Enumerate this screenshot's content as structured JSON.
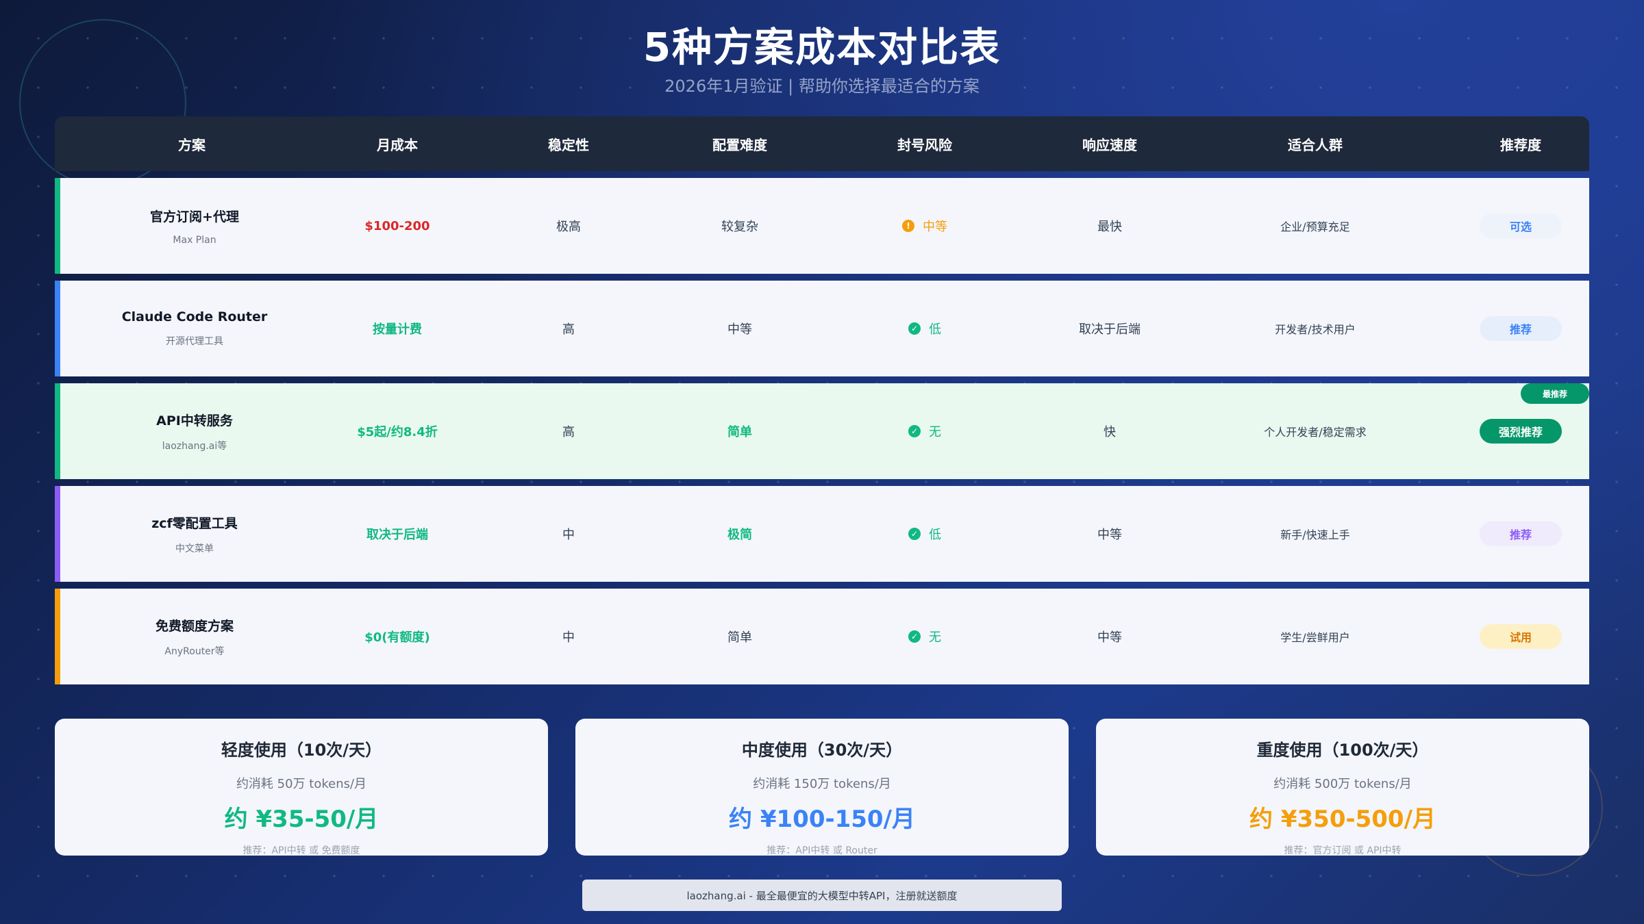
{
  "title": "5种方案成本对比表",
  "subtitle": "2026年1月验证 | 帮助你选择最适合的方案",
  "headers": [
    "方案",
    "月成本",
    "稳定性",
    "配置难度",
    "封号风险",
    "响应速度",
    "适合人群",
    "推荐度"
  ],
  "rows": [
    {
      "name": "官方订阅+代理",
      "sub": "Max Plan",
      "cost": "$100-200",
      "stability": "极高",
      "difficulty": "较复杂",
      "risk": "中等",
      "risk_icon": "!",
      "speed": "最快",
      "audience": "企业/预算充足",
      "recommend": "可选",
      "accent": "#10b981",
      "cost_color": "#dc2626",
      "difficulty_color": "#334155",
      "risk_color": "#f59e0b",
      "pill_bg": "#eef3fb",
      "pill_color": "#3b82f6"
    },
    {
      "name": "Claude Code Router",
      "sub": "开源代理工具",
      "cost": "按量计费",
      "stability": "高",
      "difficulty": "中等",
      "risk": "低",
      "risk_icon": "✓",
      "speed": "取决于后端",
      "audience": "开发者/技术用户",
      "recommend": "推荐",
      "accent": "#3b82f6",
      "cost_color": "#10b981",
      "difficulty_color": "#334155",
      "risk_color": "#10b981",
      "pill_bg": "#e6eefc",
      "pill_color": "#3b82f6"
    },
    {
      "name": "API中转服务",
      "sub": "laozhang.ai等",
      "cost": "$5起/约8.4折",
      "stability": "高",
      "difficulty": "简单",
      "risk": "无",
      "risk_icon": "✓",
      "speed": "快",
      "audience": "个人开发者/稳定需求",
      "recommend": "强烈推荐",
      "top_badge": "最推荐",
      "accent": "#10b981",
      "cost_color": "#10b981",
      "difficulty_color": "#10b981",
      "risk_color": "#10b981",
      "pill_bg": "#059669",
      "pill_color": "#ffffff"
    },
    {
      "name": "zcf零配置工具",
      "sub": "中文菜单",
      "cost": "取决于后端",
      "stability": "中",
      "difficulty": "极简",
      "risk": "低",
      "risk_icon": "✓",
      "speed": "中等",
      "audience": "新手/快速上手",
      "recommend": "推荐",
      "accent": "#8b5cf6",
      "cost_color": "#10b981",
      "difficulty_color": "#10b981",
      "risk_color": "#10b981",
      "pill_bg": "#efeafc",
      "pill_color": "#8b5cf6"
    },
    {
      "name": "免费额度方案",
      "sub": "AnyRouter等",
      "cost": "$0(有额度)",
      "stability": "中",
      "difficulty": "简单",
      "risk": "无",
      "risk_icon": "✓",
      "speed": "中等",
      "audience": "学生/尝鲜用户",
      "recommend": "试用",
      "accent": "#f59e0b",
      "cost_color": "#10b981",
      "difficulty_color": "#334155",
      "risk_color": "#10b981",
      "pill_bg": "#fdf0c4",
      "pill_color": "#d97706"
    }
  ],
  "cards": [
    {
      "title": "轻度使用（10次/天）",
      "usage": "约消耗 50万 tokens/月",
      "price": "约 ¥35-50/月",
      "rec": "推荐：API中转 或 免费额度",
      "price_color": "#10b981"
    },
    {
      "title": "中度使用（30次/天）",
      "usage": "约消耗 150万 tokens/月",
      "price": "约 ¥100-150/月",
      "rec": "推荐：API中转 或 Router",
      "price_color": "#3b82f6"
    },
    {
      "title": "重度使用（100次/天）",
      "usage": "约消耗 500万 tokens/月",
      "price": "约 ¥350-500/月",
      "rec": "推荐：官方订阅 或 API中转",
      "price_color": "#f59e0b"
    }
  ],
  "footer": "laozhang.ai - 最全最便宜的大模型中转API，注册就送额度"
}
